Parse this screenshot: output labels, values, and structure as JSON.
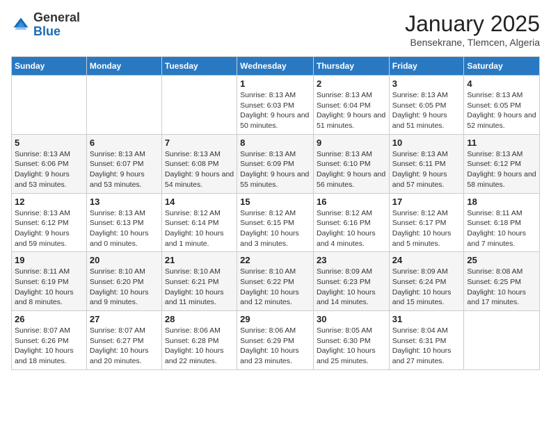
{
  "logo": {
    "general": "General",
    "blue": "Blue"
  },
  "title": "January 2025",
  "subtitle": "Bensekrane, Tlemcen, Algeria",
  "headers": [
    "Sunday",
    "Monday",
    "Tuesday",
    "Wednesday",
    "Thursday",
    "Friday",
    "Saturday"
  ],
  "weeks": [
    [
      {
        "day": "",
        "info": ""
      },
      {
        "day": "",
        "info": ""
      },
      {
        "day": "",
        "info": ""
      },
      {
        "day": "1",
        "info": "Sunrise: 8:13 AM\nSunset: 6:03 PM\nDaylight: 9 hours and 50 minutes."
      },
      {
        "day": "2",
        "info": "Sunrise: 8:13 AM\nSunset: 6:04 PM\nDaylight: 9 hours and 51 minutes."
      },
      {
        "day": "3",
        "info": "Sunrise: 8:13 AM\nSunset: 6:05 PM\nDaylight: 9 hours and 51 minutes."
      },
      {
        "day": "4",
        "info": "Sunrise: 8:13 AM\nSunset: 6:05 PM\nDaylight: 9 hours and 52 minutes."
      }
    ],
    [
      {
        "day": "5",
        "info": "Sunrise: 8:13 AM\nSunset: 6:06 PM\nDaylight: 9 hours and 53 minutes."
      },
      {
        "day": "6",
        "info": "Sunrise: 8:13 AM\nSunset: 6:07 PM\nDaylight: 9 hours and 53 minutes."
      },
      {
        "day": "7",
        "info": "Sunrise: 8:13 AM\nSunset: 6:08 PM\nDaylight: 9 hours and 54 minutes."
      },
      {
        "day": "8",
        "info": "Sunrise: 8:13 AM\nSunset: 6:09 PM\nDaylight: 9 hours and 55 minutes."
      },
      {
        "day": "9",
        "info": "Sunrise: 8:13 AM\nSunset: 6:10 PM\nDaylight: 9 hours and 56 minutes."
      },
      {
        "day": "10",
        "info": "Sunrise: 8:13 AM\nSunset: 6:11 PM\nDaylight: 9 hours and 57 minutes."
      },
      {
        "day": "11",
        "info": "Sunrise: 8:13 AM\nSunset: 6:12 PM\nDaylight: 9 hours and 58 minutes."
      }
    ],
    [
      {
        "day": "12",
        "info": "Sunrise: 8:13 AM\nSunset: 6:12 PM\nDaylight: 9 hours and 59 minutes."
      },
      {
        "day": "13",
        "info": "Sunrise: 8:13 AM\nSunset: 6:13 PM\nDaylight: 10 hours and 0 minutes."
      },
      {
        "day": "14",
        "info": "Sunrise: 8:12 AM\nSunset: 6:14 PM\nDaylight: 10 hours and 1 minute."
      },
      {
        "day": "15",
        "info": "Sunrise: 8:12 AM\nSunset: 6:15 PM\nDaylight: 10 hours and 3 minutes."
      },
      {
        "day": "16",
        "info": "Sunrise: 8:12 AM\nSunset: 6:16 PM\nDaylight: 10 hours and 4 minutes."
      },
      {
        "day": "17",
        "info": "Sunrise: 8:12 AM\nSunset: 6:17 PM\nDaylight: 10 hours and 5 minutes."
      },
      {
        "day": "18",
        "info": "Sunrise: 8:11 AM\nSunset: 6:18 PM\nDaylight: 10 hours and 7 minutes."
      }
    ],
    [
      {
        "day": "19",
        "info": "Sunrise: 8:11 AM\nSunset: 6:19 PM\nDaylight: 10 hours and 8 minutes."
      },
      {
        "day": "20",
        "info": "Sunrise: 8:10 AM\nSunset: 6:20 PM\nDaylight: 10 hours and 9 minutes."
      },
      {
        "day": "21",
        "info": "Sunrise: 8:10 AM\nSunset: 6:21 PM\nDaylight: 10 hours and 11 minutes."
      },
      {
        "day": "22",
        "info": "Sunrise: 8:10 AM\nSunset: 6:22 PM\nDaylight: 10 hours and 12 minutes."
      },
      {
        "day": "23",
        "info": "Sunrise: 8:09 AM\nSunset: 6:23 PM\nDaylight: 10 hours and 14 minutes."
      },
      {
        "day": "24",
        "info": "Sunrise: 8:09 AM\nSunset: 6:24 PM\nDaylight: 10 hours and 15 minutes."
      },
      {
        "day": "25",
        "info": "Sunrise: 8:08 AM\nSunset: 6:25 PM\nDaylight: 10 hours and 17 minutes."
      }
    ],
    [
      {
        "day": "26",
        "info": "Sunrise: 8:07 AM\nSunset: 6:26 PM\nDaylight: 10 hours and 18 minutes."
      },
      {
        "day": "27",
        "info": "Sunrise: 8:07 AM\nSunset: 6:27 PM\nDaylight: 10 hours and 20 minutes."
      },
      {
        "day": "28",
        "info": "Sunrise: 8:06 AM\nSunset: 6:28 PM\nDaylight: 10 hours and 22 minutes."
      },
      {
        "day": "29",
        "info": "Sunrise: 8:06 AM\nSunset: 6:29 PM\nDaylight: 10 hours and 23 minutes."
      },
      {
        "day": "30",
        "info": "Sunrise: 8:05 AM\nSunset: 6:30 PM\nDaylight: 10 hours and 25 minutes."
      },
      {
        "day": "31",
        "info": "Sunrise: 8:04 AM\nSunset: 6:31 PM\nDaylight: 10 hours and 27 minutes."
      },
      {
        "day": "",
        "info": ""
      }
    ]
  ]
}
